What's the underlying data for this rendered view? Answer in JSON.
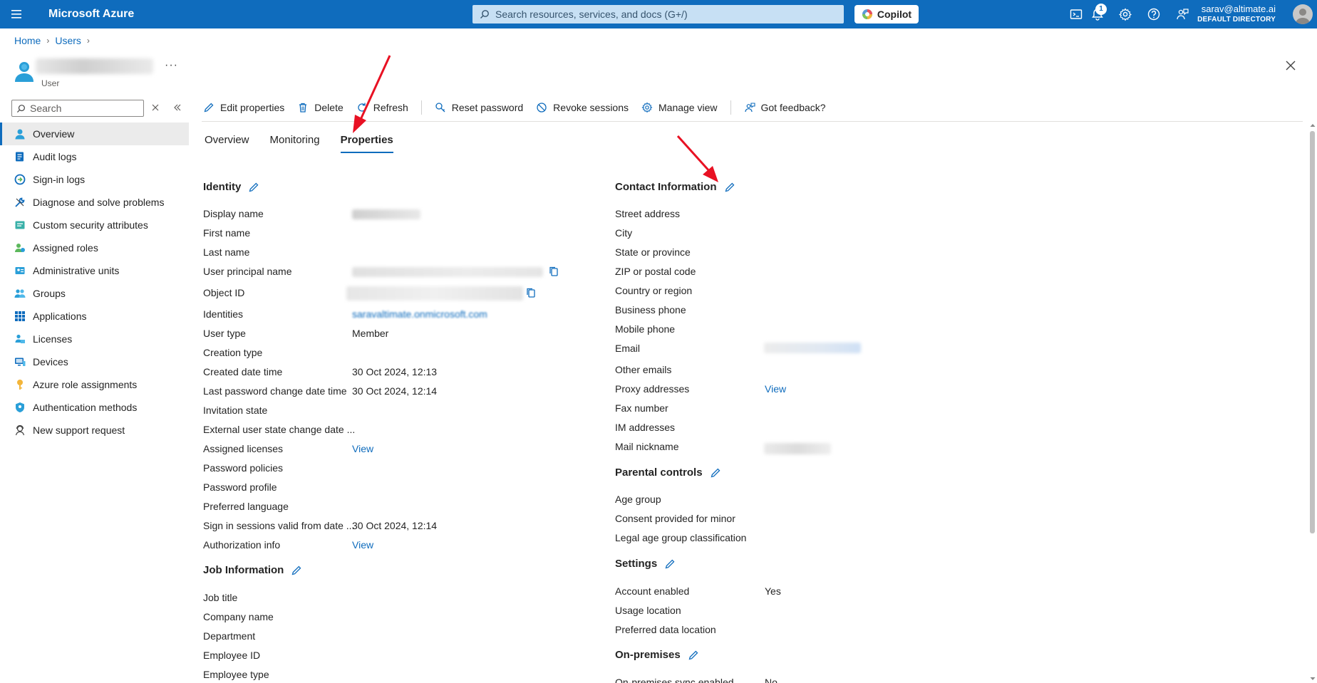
{
  "topbar": {
    "brand": "Microsoft Azure",
    "search_placeholder": "Search resources, services, and docs (G+/)",
    "copilot_label": "Copilot",
    "notification_count": "1",
    "account_email": "sarav@altimate.ai",
    "account_directory": "DEFAULT DIRECTORY"
  },
  "breadcrumb": {
    "home": "Home",
    "users": "Users"
  },
  "header": {
    "subtitle": "User"
  },
  "sidebar": {
    "search_placeholder": "Search",
    "items": [
      {
        "label": "Overview",
        "icon": "user-icon"
      },
      {
        "label": "Audit logs",
        "icon": "audit-log-icon"
      },
      {
        "label": "Sign-in logs",
        "icon": "sign-in-log-icon"
      },
      {
        "label": "Diagnose and solve problems",
        "icon": "wrench-icon"
      },
      {
        "label": "Custom security attributes",
        "icon": "security-attributes-icon"
      },
      {
        "label": "Assigned roles",
        "icon": "assigned-roles-icon"
      },
      {
        "label": "Administrative units",
        "icon": "admin-units-icon"
      },
      {
        "label": "Groups",
        "icon": "groups-icon"
      },
      {
        "label": "Applications",
        "icon": "applications-grid-icon"
      },
      {
        "label": "Licenses",
        "icon": "licenses-icon"
      },
      {
        "label": "Devices",
        "icon": "devices-icon"
      },
      {
        "label": "Azure role assignments",
        "icon": "key-icon"
      },
      {
        "label": "Authentication methods",
        "icon": "shield-icon"
      },
      {
        "label": "New support request",
        "icon": "support-icon"
      }
    ]
  },
  "toolbar": {
    "edit": "Edit properties",
    "delete": "Delete",
    "refresh": "Refresh",
    "reset_password": "Reset password",
    "revoke_sessions": "Revoke sessions",
    "manage_view": "Manage view",
    "feedback": "Got feedback?"
  },
  "tabs": [
    "Overview",
    "Monitoring",
    "Properties"
  ],
  "identity": {
    "title": "Identity",
    "rows": [
      {
        "label": "Display name",
        "value": ""
      },
      {
        "label": "First name",
        "value": ""
      },
      {
        "label": "Last name",
        "value": ""
      },
      {
        "label": "User principal name",
        "value": ""
      },
      {
        "label": "Object ID",
        "value": ""
      },
      {
        "label": "Identities",
        "value": "saravaltimate.onmicrosoft.com"
      },
      {
        "label": "User type",
        "value": "Member"
      },
      {
        "label": "Creation type",
        "value": ""
      },
      {
        "label": "Created date time",
        "value": "30 Oct 2024, 12:13"
      },
      {
        "label": "Last password change date time",
        "value": "30 Oct 2024, 12:14"
      },
      {
        "label": "Invitation state",
        "value": ""
      },
      {
        "label": "External user state change date ...",
        "value": ""
      },
      {
        "label": "Assigned licenses",
        "value": "View"
      },
      {
        "label": "Password policies",
        "value": ""
      },
      {
        "label": "Password profile",
        "value": ""
      },
      {
        "label": "Preferred language",
        "value": ""
      },
      {
        "label": "Sign in sessions valid from date ...",
        "value": "30 Oct 2024, 12:14"
      },
      {
        "label": "Authorization info",
        "value": "View"
      }
    ]
  },
  "job": {
    "title": "Job Information",
    "rows": [
      {
        "label": "Job title"
      },
      {
        "label": "Company name"
      },
      {
        "label": "Department"
      },
      {
        "label": "Employee ID"
      },
      {
        "label": "Employee type"
      }
    ]
  },
  "contact": {
    "title": "Contact Information",
    "rows": [
      {
        "label": "Street address",
        "value": ""
      },
      {
        "label": "City",
        "value": ""
      },
      {
        "label": "State or province",
        "value": ""
      },
      {
        "label": "ZIP or postal code",
        "value": ""
      },
      {
        "label": "Country or region",
        "value": ""
      },
      {
        "label": "Business phone",
        "value": ""
      },
      {
        "label": "Mobile phone",
        "value": ""
      },
      {
        "label": "Email",
        "value": ""
      },
      {
        "label": "Other emails",
        "value": ""
      },
      {
        "label": "Proxy addresses",
        "value": "View"
      },
      {
        "label": "Fax number",
        "value": ""
      },
      {
        "label": "IM addresses",
        "value": ""
      },
      {
        "label": "Mail nickname",
        "value": ""
      }
    ]
  },
  "parental": {
    "title": "Parental controls",
    "rows": [
      {
        "label": "Age group"
      },
      {
        "label": "Consent provided for minor"
      },
      {
        "label": "Legal age group classification"
      }
    ]
  },
  "settings": {
    "title": "Settings",
    "rows": [
      {
        "label": "Account enabled",
        "value": "Yes"
      },
      {
        "label": "Usage location",
        "value": ""
      },
      {
        "label": "Preferred data location",
        "value": ""
      }
    ]
  },
  "onprem": {
    "title": "On-premises",
    "rows": [
      {
        "label": "On-premises sync enabled",
        "value": "No"
      }
    ]
  },
  "colors": {
    "accent": "#0f6cbd",
    "annotation": "#e81123"
  }
}
